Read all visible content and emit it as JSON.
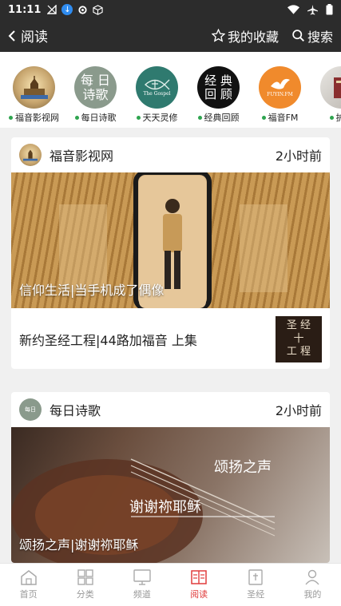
{
  "status": {
    "time": "11:11"
  },
  "header": {
    "back_label": "阅读",
    "favorites_label": "我的收藏",
    "search_label": "搜索"
  },
  "channels": [
    {
      "label": "福音影视网",
      "art": "",
      "bg": "#c7a56e"
    },
    {
      "label": "每日诗歌",
      "art": "每 日\n诗歌",
      "bg": "#8a9a8c"
    },
    {
      "label": "天天灵修",
      "art": "The Gospel",
      "bg": "#2f7a6f"
    },
    {
      "label": "经典回顾",
      "art": "经 典\n回 顾",
      "bg": "#111111"
    },
    {
      "label": "福音FM",
      "art": "FUYIN.FM",
      "bg": "#f08a2c"
    },
    {
      "label": "护教",
      "art": "",
      "bg": "#8a3a3a"
    }
  ],
  "cards": [
    {
      "source": "福音影视网",
      "time": "2小时前",
      "hero_caption": "信仰生活|当手机成了偶像",
      "second_title": "新约圣经工程|44路加福音 上集",
      "thumb_text": "圣 经\n十\n工 程"
    },
    {
      "source": "每日诗歌",
      "time": "2小时前",
      "hero_overlay_top": "颂扬之声",
      "hero_overlay_mid": "谢谢祢耶稣",
      "hero_caption": "颂扬之声|谢谢祢耶稣"
    }
  ],
  "tabbar": [
    {
      "label": "首页",
      "icon": "home-icon"
    },
    {
      "label": "分类",
      "icon": "grid-icon"
    },
    {
      "label": "频道",
      "icon": "tv-icon"
    },
    {
      "label": "阅读",
      "icon": "book-icon"
    },
    {
      "label": "圣经",
      "icon": "bible-icon"
    },
    {
      "label": "我的",
      "icon": "user-icon"
    }
  ],
  "colors": {
    "accent": "#e03c3c",
    "header_bg": "#2c2c2c"
  }
}
